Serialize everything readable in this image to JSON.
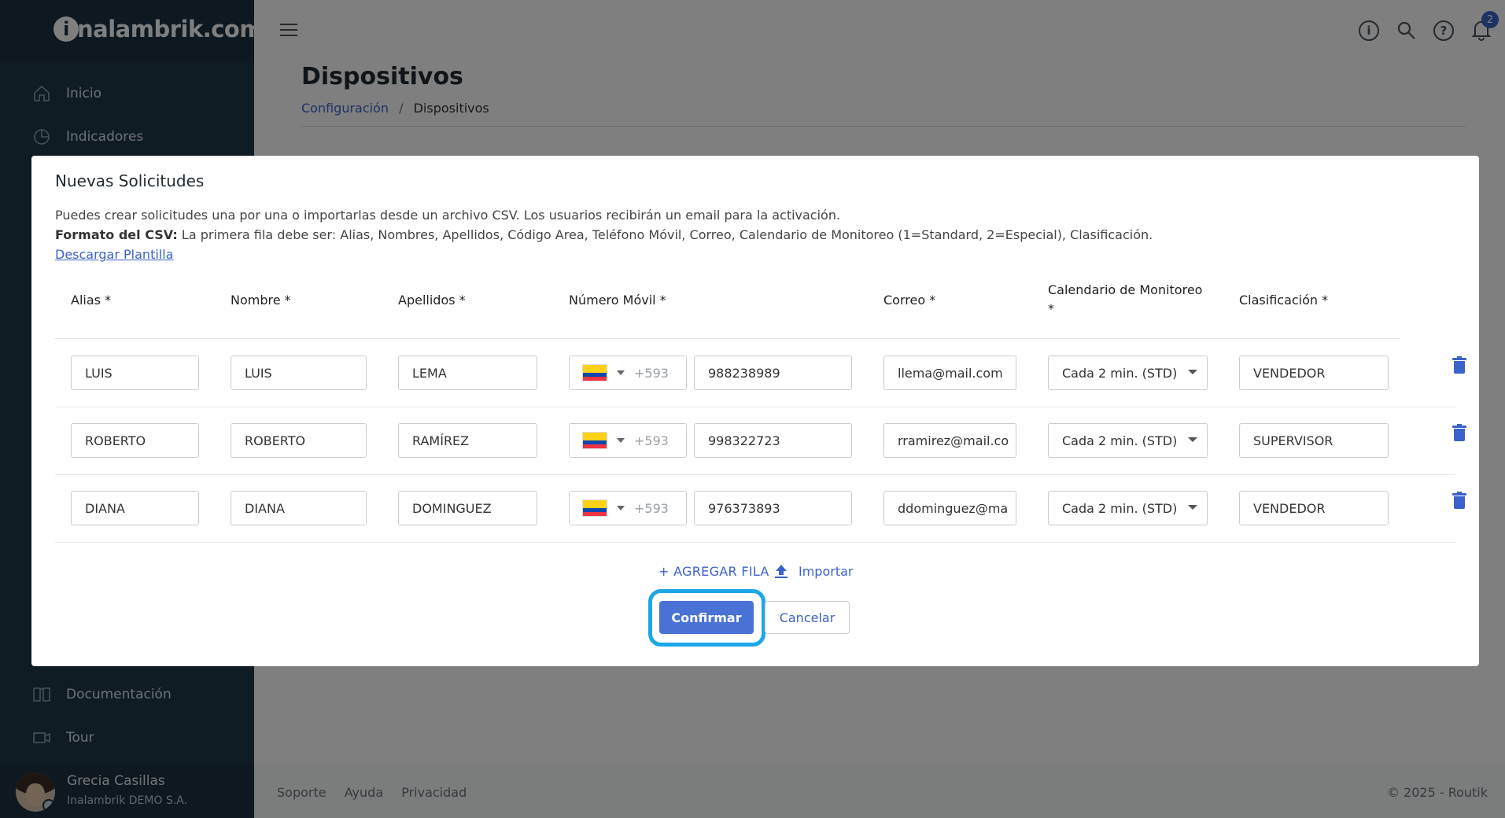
{
  "app": {
    "logo_text": "nalambrik.com",
    "logo_initial": "i"
  },
  "sidebar": {
    "items": [
      {
        "label": "Inicio",
        "icon": "home-icon"
      },
      {
        "label": "Indicadores",
        "icon": "pie-chart-icon"
      },
      {
        "label": "Documentación",
        "icon": "book-icon"
      },
      {
        "label": "Tour",
        "icon": "video-icon"
      }
    ],
    "user": {
      "name": "Grecia Casillas",
      "company": "Inalambrik DEMO S.A."
    }
  },
  "topbar": {
    "notifications_count": "2"
  },
  "page": {
    "title": "Dispositivos",
    "breadcrumb": {
      "parent": "Configuración",
      "separator": "/",
      "current": "Dispositivos"
    }
  },
  "footer": {
    "links": [
      "Soporte",
      "Ayuda",
      "Privacidad"
    ],
    "copyright": "© 2025 - Routik"
  },
  "modal": {
    "title": "Nuevas Solicitudes",
    "description": "Puedes crear solicitudes una por una o importarlas desde un archivo CSV. Los usuarios recibirán un email para la activación.",
    "csv_label": "Formato del CSV:",
    "csv_text": " La primera fila debe ser: Alias, Nombres, Apellidos, Código Area, Teléfono Móvil, Correo, Calendario de Monitoreo (1=Standard, 2=Especial), Clasificación.",
    "download_link": "Descargar Plantilla",
    "columns": {
      "alias": "Alias *",
      "nombre": "Nombre *",
      "apellidos": "Apellidos *",
      "movil": "Número Móvil *",
      "correo": "Correo *",
      "calendario": "Calendario de Monitoreo",
      "calendario_req": "*",
      "clasificacion": "Clasificación *"
    },
    "rows": [
      {
        "alias": "LUIS",
        "nombre": "LUIS",
        "apellidos": "LEMA",
        "prefix": "+593",
        "phone": "988238989",
        "email": "llema@mail.com",
        "calendar": "Cada 2 min. (STD)",
        "classification": "VENDEDOR"
      },
      {
        "alias": "ROBERTO",
        "nombre": "ROBERTO",
        "apellidos": "RAMÍREZ",
        "prefix": "+593",
        "phone": "998322723",
        "email": "rramirez@mail.co",
        "calendar": "Cada 2 min. (STD)",
        "classification": "SUPERVISOR"
      },
      {
        "alias": "DIANA",
        "nombre": "DIANA",
        "apellidos": "DOMINGUEZ",
        "prefix": "+593",
        "phone": "976373893",
        "email": "ddominguez@ma",
        "calendar": "Cada 2 min. (STD)",
        "classification": "VENDEDOR"
      }
    ],
    "add_row_label": "+ AGREGAR FILA",
    "import_label": "Importar",
    "confirm_label": "Confirmar",
    "cancel_label": "Cancelar"
  },
  "colors": {
    "accent": "#3b62c9",
    "sidebar": "#1f3849",
    "highlight_ring": "#1ea7e8"
  }
}
